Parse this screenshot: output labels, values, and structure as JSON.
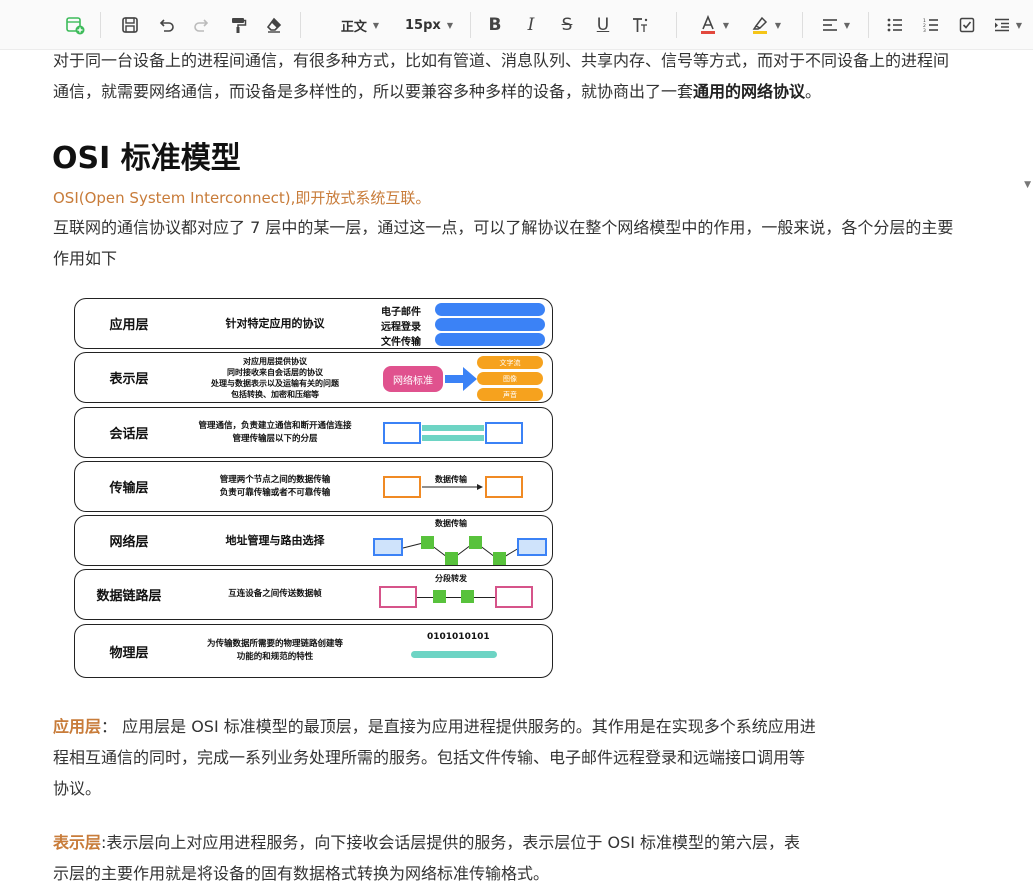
{
  "toolbar": {
    "paragraph_style": "正文",
    "font_size": "15px",
    "colors": {
      "accent": "#3dbb5a",
      "font_color_bar": "#e2483d",
      "highlight_bar": "#f5c518"
    }
  },
  "document": {
    "intro_line1": "对于同一台设备上的进程间通信，有很多种方式，比如有管道、消息队列、共享内存、信号等方式，而对于不同设备上的进程间",
    "intro_line2_plain": "通信，就需要网络通信，而设备是多样性的，所以要兼容多种多样的设备，就协商出了一套",
    "intro_line2_bold": "通用的网络协议",
    "intro_line2_end": "。",
    "heading": "OSI 标准模型",
    "osi_def": "OSI(Open System Interconnect),即开放式系统互联。",
    "osi_line1": "互联网的通信协议都对应了 7 层中的某一层，通过这一点，可以了解协议在整个网络模型中的作用，一般来说，各个分层的主要",
    "osi_line2": "作用如下",
    "app_label": "应用层",
    "app_sep": "：",
    "app_line1": " 应用层是 OSI 标准模型的最顶层，是直接为应用进程提供服务的。其作用是在实现多个系统应用进",
    "app_line2": "程相互通信的同时，完成一系列业务处理所需的服务。包括文件传输、电子邮件远程登录和远端接口调用等",
    "app_line3": "协议。",
    "pres_label": "表示层",
    "pres_line1": ":表示层向上对应用进程服务，向下接收会话层提供的服务，表示层位于 OSI 标准模型的第六层，表",
    "pres_line2": "示层的主要作用就是将设备的固有数据格式转换为网络标准传输格式。"
  },
  "diagram": {
    "layers": [
      {
        "name": "应用层",
        "desc": [
          "针对特定应用的协议"
        ],
        "items": [
          "电子邮件",
          "远程登录",
          "文件传输"
        ]
      },
      {
        "name": "表示层",
        "desc": [
          "对应用层提供协议",
          "同时接收来自会话层的协议",
          "处理与数据表示以及运输有关的问题",
          "包括转换、加密和压缩等"
        ],
        "box": "网络标准",
        "chips": [
          "文字流",
          "图像",
          "声音"
        ]
      },
      {
        "name": "会话层",
        "desc": [
          "管理通信，负责建立通信和断开通信连接",
          "管理传输层以下的分层"
        ]
      },
      {
        "name": "传输层",
        "desc": [
          "管理两个节点之间的数据传输",
          "负责可靠传输或者不可靠传输"
        ],
        "caption": "数据传输"
      },
      {
        "name": "网络层",
        "desc": [
          "地址管理与路由选择"
        ],
        "caption": "数据传输"
      },
      {
        "name": "数据链路层",
        "desc": [
          "互连设备之间传送数据帧"
        ],
        "caption": "分段转发"
      },
      {
        "name": "物理层",
        "desc": [
          "为传输数据所需要的物理链路创建等",
          "功能的和规范的特性"
        ],
        "caption": "0101010101"
      }
    ]
  }
}
